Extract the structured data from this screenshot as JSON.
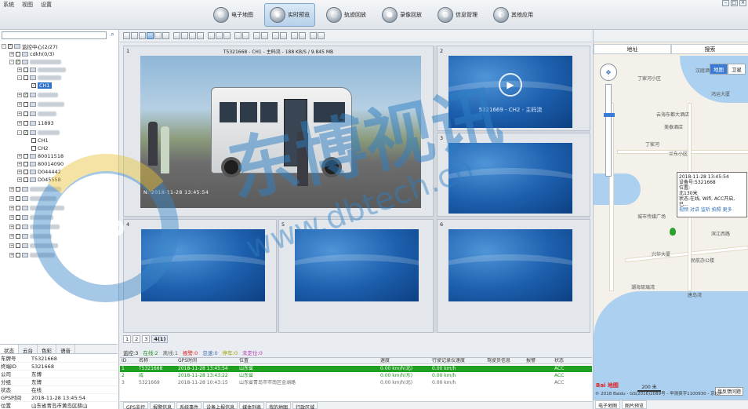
{
  "menu": [
    "系统",
    "视图",
    "设置"
  ],
  "nav_tabs": [
    {
      "label": "电子地图",
      "icon": "map-icon",
      "active": false
    },
    {
      "label": "实时预览",
      "icon": "preview-icon",
      "active": true
    },
    {
      "label": "轨迹回放",
      "icon": "track-icon",
      "active": false
    },
    {
      "label": "录像回放",
      "icon": "record-icon",
      "active": false
    },
    {
      "label": "信息管理",
      "icon": "info-icon",
      "active": false
    },
    {
      "label": "其他应用",
      "icon": "apps-icon",
      "active": false
    }
  ],
  "tree": {
    "root": "监控中心(2/27)",
    "items": [
      {
        "text": "cdkh(0/3)"
      },
      {
        "text": "CH1",
        "selected": true
      },
      {
        "text": "11893"
      },
      {
        "text": "CH1"
      },
      {
        "text": "CH2"
      },
      {
        "text": "80011518"
      },
      {
        "text": "80014090"
      },
      {
        "text": "D044442"
      },
      {
        "text": "D045558"
      }
    ]
  },
  "left_tabs": [
    "状态",
    "云台",
    "色彩",
    "语音"
  ],
  "props": [
    {
      "k": "车牌号",
      "v": "T5321668"
    },
    {
      "k": "终端ID",
      "v": "5321668"
    },
    {
      "k": "公司",
      "v": "东博"
    },
    {
      "k": "分组",
      "v": "东博"
    },
    {
      "k": "状态",
      "v": "在线"
    },
    {
      "k": "GPS时间",
      "v": "2018-11-28 13:45:54"
    },
    {
      "k": "位置",
      "v": "山东省青岛市黄岛区薛山"
    },
    {
      "k": "速度",
      "v": "0.00 km/h(北)"
    },
    {
      "k": "使用",
      "v": "正常"
    }
  ],
  "video": {
    "main_title": "T5321668 - CH1 - 主码流 - 188 KB/S / 9.845 MB",
    "main_timestamp": "N: 2018-11-28 13:45:54",
    "cell2_label": "5321669 - CH2 - 主码流",
    "cell_numbers": [
      "1",
      "2",
      "3",
      "4",
      "5",
      "6"
    ]
  },
  "pager": [
    "1",
    "2",
    "3",
    "4(1)"
  ],
  "status": [
    {
      "label": "监控:3",
      "color": "#222"
    },
    {
      "label": "在线:2",
      "color": "#1c8f1c"
    },
    {
      "label": "离线:1",
      "color": "#666"
    },
    {
      "label": "报警:0",
      "color": "#d22"
    },
    {
      "label": "怠速:0",
      "color": "#3a6cb0"
    },
    {
      "label": "停车:0",
      "color": "#a0a000"
    },
    {
      "label": "未定位:0",
      "color": "#b03ab0"
    }
  ],
  "grid": {
    "headers": [
      "ID",
      "名称",
      "GPS时间",
      "位置",
      "速度",
      "行驶记录仪速度",
      "驾驶员信息",
      "报警",
      "状态"
    ],
    "rows": [
      {
        "cells": [
          "1",
          "T5321668",
          "2018-11-28 13:45:54",
          "山东省",
          "0.00 km/h(北)",
          "0.00 km/h",
          "",
          "",
          "ACC"
        ],
        "kind": "green"
      },
      {
        "cells": [
          "2",
          "成",
          "2018-11-28 13:43:22",
          "山东省",
          "0.00 km/h(东)",
          "0.00 km/h",
          "",
          "",
          "ACC"
        ],
        "kind": "online"
      },
      {
        "cells": [
          "3",
          "5321669",
          "2018-11-28 10:43:15",
          "山东省青岛市市南区金湖路",
          "0.00 km/h(北)",
          "0.00 km/h",
          "",
          "",
          "ACC"
        ],
        "kind": "off"
      }
    ]
  },
  "bottom_tabs": [
    "GPS监控",
    "报警信息",
    "系统事件",
    "设备上报信息",
    "媒体列表",
    "我的地图",
    "行政区域"
  ],
  "map": {
    "tabs": [
      "地址",
      "搜索"
    ],
    "type_buttons": [
      "地图",
      "卫星"
    ],
    "labels": [
      "汉庭酒店",
      "鸿运大厦",
      "丁家河小区",
      "云海东都大酒店",
      "美泰酒店",
      "丁家河",
      "兰东小区",
      "城市传媒广场",
      "滨江西路",
      "兴华大厦",
      "民航办公楼",
      "潮海琉璃湾",
      "唐岛湾"
    ],
    "popup": {
      "time": "2018-11-28 13:45:54",
      "device": "设备号:5321668",
      "position": "位置:",
      "coords": "北130米",
      "status": "状态:在线, Wifi, ACC开启, 已...",
      "links": "视频 对讲 监听 拍照 更多"
    },
    "scale": "200 米",
    "copyright": "© 2018 Baidu - GS(2016)2089号 - 甲测资字1100930 - 京ICP",
    "feedback": "我反馈问题",
    "baidu": "Bai 地图"
  },
  "right_bottom_tabs": [
    "电子地图",
    "图片预览"
  ],
  "watermark": {
    "cn": "东博视讯",
    "url": "www.dbtech.cn",
    "logo": "db"
  }
}
